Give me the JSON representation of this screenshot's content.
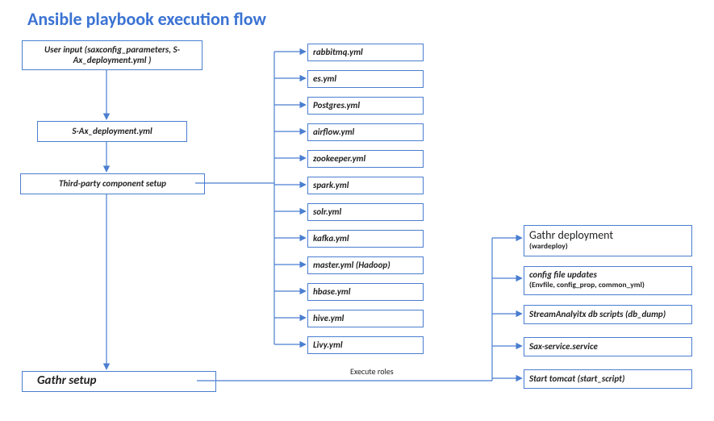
{
  "title": "Ansible playbook execution flow",
  "left": {
    "user_input": "User input (saxconfig_parameters, S-Ax_deployment.yml )",
    "deployment": "S-Ax_deployment.yml",
    "third_party": "Third-party component setup",
    "gathr_setup": "Gathr setup"
  },
  "yml": [
    "rabbitmq.yml",
    "es.yml",
    "Postgres.yml",
    "airflow.yml",
    "zookeeper.yml",
    "spark.yml",
    "solr.yml",
    "kafka.yml",
    "master.yml (Hadoop)",
    "hbase.yml",
    "hive.yml",
    "Livy.yml"
  ],
  "roles_label": "Execute roles",
  "right": {
    "deploy_title": "Gathr deployment",
    "deploy_sub": "(wardeploy)",
    "config_title": "config file updates",
    "config_sub": "(Envfile, config_prop, common_yml)",
    "db": "StreamAnalyitx db scripts (db_dump)",
    "sax": "Sax-service.service",
    "tomcat": "Start tomcat (start_script)"
  }
}
